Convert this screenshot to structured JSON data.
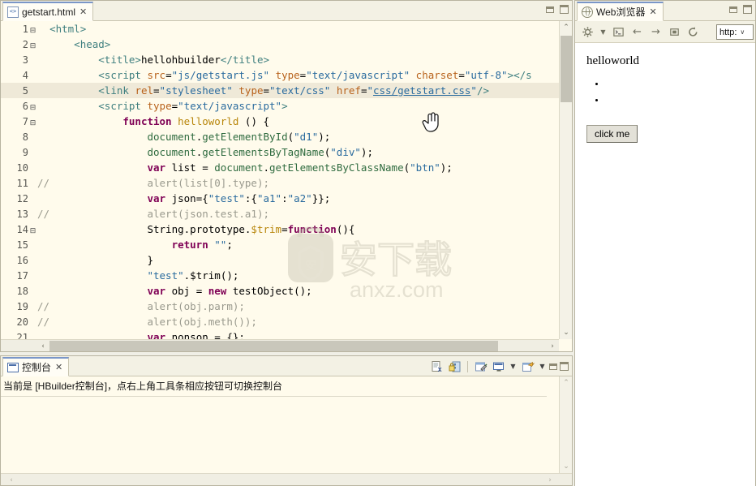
{
  "editor": {
    "tab": {
      "label": "getstart.html",
      "close": "✕",
      "icon": "html-file-icon"
    },
    "window_buttons": {
      "minimize": "minimize",
      "maximize": "maximize"
    },
    "lines": [
      {
        "num": "1",
        "fold": "⊟",
        "hl": false,
        "tokens": [
          {
            "t": "<",
            "c": "tag"
          },
          {
            "t": "html",
            "c": "tag"
          },
          {
            "t": ">",
            "c": "tag"
          }
        ]
      },
      {
        "num": "2",
        "fold": "⊟",
        "hl": false,
        "tokens": [
          {
            "t": "    ",
            "c": "plain"
          },
          {
            "t": "<head>",
            "c": "tag"
          }
        ]
      },
      {
        "num": "3",
        "fold": "",
        "hl": false,
        "tokens": [
          {
            "t": "        ",
            "c": "plain"
          },
          {
            "t": "<title>",
            "c": "tag"
          },
          {
            "t": "hellohbuilder",
            "c": "plain"
          },
          {
            "t": "</title>",
            "c": "tag"
          }
        ]
      },
      {
        "num": "4",
        "fold": "",
        "hl": false,
        "tokens": [
          {
            "t": "        ",
            "c": "plain"
          },
          {
            "t": "<script ",
            "c": "tag"
          },
          {
            "t": "src",
            "c": "attr2"
          },
          {
            "t": "=",
            "c": "plain"
          },
          {
            "t": "\"js/getstart.js\"",
            "c": "str"
          },
          {
            "t": " ",
            "c": "plain"
          },
          {
            "t": "type",
            "c": "attr2"
          },
          {
            "t": "=",
            "c": "plain"
          },
          {
            "t": "\"text/javascript\"",
            "c": "str"
          },
          {
            "t": " ",
            "c": "plain"
          },
          {
            "t": "charset",
            "c": "attr2"
          },
          {
            "t": "=",
            "c": "plain"
          },
          {
            "t": "\"utf-8\"",
            "c": "str"
          },
          {
            "t": "></s",
            "c": "tag"
          }
        ]
      },
      {
        "num": "5",
        "fold": "",
        "hl": true,
        "tokens": [
          {
            "t": "        ",
            "c": "plain"
          },
          {
            "t": "<link ",
            "c": "tag"
          },
          {
            "t": "rel",
            "c": "attr2"
          },
          {
            "t": "=",
            "c": "plain"
          },
          {
            "t": "\"stylesheet\"",
            "c": "str"
          },
          {
            "t": " ",
            "c": "plain"
          },
          {
            "t": "type",
            "c": "attr2"
          },
          {
            "t": "=",
            "c": "plain"
          },
          {
            "t": "\"text/css\"",
            "c": "str"
          },
          {
            "t": " ",
            "c": "plain"
          },
          {
            "t": "href",
            "c": "attr2"
          },
          {
            "t": "=",
            "c": "plain"
          },
          {
            "t": "\"",
            "c": "str"
          },
          {
            "t": "css/getstart.css",
            "c": "lnk"
          },
          {
            "t": "\"",
            "c": "str"
          },
          {
            "t": "/>",
            "c": "tag"
          }
        ]
      },
      {
        "num": "6",
        "fold": "⊟",
        "hl": false,
        "tokens": [
          {
            "t": "        ",
            "c": "plain"
          },
          {
            "t": "<script ",
            "c": "tag"
          },
          {
            "t": "type",
            "c": "attr2"
          },
          {
            "t": "=",
            "c": "plain"
          },
          {
            "t": "\"text/javascript\"",
            "c": "str"
          },
          {
            "t": ">",
            "c": "tag"
          }
        ]
      },
      {
        "num": "7",
        "fold": "⊟",
        "hl": false,
        "tokens": [
          {
            "t": "            ",
            "c": "plain"
          },
          {
            "t": "function",
            "c": "kw"
          },
          {
            "t": " ",
            "c": "plain"
          },
          {
            "t": "helloworld",
            "c": "fn"
          },
          {
            "t": " () {",
            "c": "plain"
          }
        ]
      },
      {
        "num": "8",
        "fold": "",
        "hl": false,
        "tokens": [
          {
            "t": "                ",
            "c": "plain"
          },
          {
            "t": "document",
            "c": "meth"
          },
          {
            "t": ".",
            "c": "plain"
          },
          {
            "t": "getElementById",
            "c": "meth"
          },
          {
            "t": "(",
            "c": "plain"
          },
          {
            "t": "\"d1\"",
            "c": "str"
          },
          {
            "t": ");",
            "c": "plain"
          }
        ]
      },
      {
        "num": "9",
        "fold": "",
        "hl": false,
        "tokens": [
          {
            "t": "                ",
            "c": "plain"
          },
          {
            "t": "document",
            "c": "meth"
          },
          {
            "t": ".",
            "c": "plain"
          },
          {
            "t": "getElementsByTagName",
            "c": "meth"
          },
          {
            "t": "(",
            "c": "plain"
          },
          {
            "t": "\"div\"",
            "c": "str"
          },
          {
            "t": ");",
            "c": "plain"
          }
        ]
      },
      {
        "num": "10",
        "fold": "",
        "hl": false,
        "tokens": [
          {
            "t": "                ",
            "c": "plain"
          },
          {
            "t": "var",
            "c": "kw"
          },
          {
            "t": " list = ",
            "c": "plain"
          },
          {
            "t": "document",
            "c": "meth"
          },
          {
            "t": ".",
            "c": "plain"
          },
          {
            "t": "getElementsByClassName",
            "c": "meth"
          },
          {
            "t": "(",
            "c": "plain"
          },
          {
            "t": "\"btn\"",
            "c": "str"
          },
          {
            "t": ");",
            "c": "plain"
          }
        ]
      },
      {
        "num": "11",
        "fold": "",
        "hl": false,
        "comment": "//",
        "tokens": [
          {
            "t": "                ",
            "c": "plain"
          },
          {
            "t": "alert(list[0].type);",
            "c": "cmt"
          }
        ]
      },
      {
        "num": "12",
        "fold": "",
        "hl": false,
        "tokens": [
          {
            "t": "                ",
            "c": "plain"
          },
          {
            "t": "var",
            "c": "kw"
          },
          {
            "t": " json={",
            "c": "plain"
          },
          {
            "t": "\"test\"",
            "c": "str"
          },
          {
            "t": ":{",
            "c": "plain"
          },
          {
            "t": "\"a1\"",
            "c": "str"
          },
          {
            "t": ":",
            "c": "plain"
          },
          {
            "t": "\"a2\"",
            "c": "str"
          },
          {
            "t": "}};",
            "c": "plain"
          }
        ]
      },
      {
        "num": "13",
        "fold": "",
        "hl": false,
        "comment": "//",
        "tokens": [
          {
            "t": "                ",
            "c": "plain"
          },
          {
            "t": "alert(json.test.a1);",
            "c": "cmt"
          }
        ]
      },
      {
        "num": "14",
        "fold": "⊟",
        "hl": false,
        "tokens": [
          {
            "t": "                ",
            "c": "plain"
          },
          {
            "t": "String.prototype.",
            "c": "plain"
          },
          {
            "t": "$trim",
            "c": "fn"
          },
          {
            "t": "=",
            "c": "plain"
          },
          {
            "t": "function",
            "c": "kw"
          },
          {
            "t": "(){",
            "c": "plain"
          }
        ]
      },
      {
        "num": "15",
        "fold": "",
        "hl": false,
        "tokens": [
          {
            "t": "                    ",
            "c": "plain"
          },
          {
            "t": "return",
            "c": "kw"
          },
          {
            "t": " ",
            "c": "plain"
          },
          {
            "t": "\"\"",
            "c": "str"
          },
          {
            "t": ";",
            "c": "plain"
          }
        ]
      },
      {
        "num": "16",
        "fold": "",
        "hl": false,
        "tokens": [
          {
            "t": "                ",
            "c": "plain"
          },
          {
            "t": "}",
            "c": "plain"
          }
        ]
      },
      {
        "num": "17",
        "fold": "",
        "hl": false,
        "tokens": [
          {
            "t": "                ",
            "c": "plain"
          },
          {
            "t": "\"test\"",
            "c": "str"
          },
          {
            "t": ".",
            "c": "plain"
          },
          {
            "t": "$trim",
            "c": "plain"
          },
          {
            "t": "();",
            "c": "plain"
          }
        ]
      },
      {
        "num": "18",
        "fold": "",
        "hl": false,
        "tokens": [
          {
            "t": "                ",
            "c": "plain"
          },
          {
            "t": "var",
            "c": "kw"
          },
          {
            "t": " obj = ",
            "c": "plain"
          },
          {
            "t": "new",
            "c": "kw"
          },
          {
            "t": " testObject();",
            "c": "plain"
          }
        ]
      },
      {
        "num": "19",
        "fold": "",
        "hl": false,
        "comment": "//",
        "tokens": [
          {
            "t": "                ",
            "c": "plain"
          },
          {
            "t": "alert(obj.parm);",
            "c": "cmt"
          }
        ]
      },
      {
        "num": "20",
        "fold": "",
        "hl": false,
        "comment": "//",
        "tokens": [
          {
            "t": "                ",
            "c": "plain"
          },
          {
            "t": "alert(obj.meth());",
            "c": "cmt"
          }
        ]
      },
      {
        "num": "21",
        "fold": "",
        "hl": false,
        "tokens": [
          {
            "t": "                ",
            "c": "plain"
          },
          {
            "t": "var",
            "c": "kw"
          },
          {
            "t": " nonson = {};",
            "c": "plain"
          }
        ]
      }
    ],
    "scroll": {
      "up_arrow": "⌃",
      "down_arrow": "⌄",
      "left_arrow": "‹",
      "right_arrow": "›"
    }
  },
  "browser": {
    "tab": {
      "label": "Web浏览器",
      "close": "✕",
      "icon": "globe-icon"
    },
    "window_buttons": {
      "minimize": "minimize",
      "maximize": "maximize"
    },
    "toolbar": {
      "settings_icon": "⚙",
      "settings_caret": "▼",
      "terminal_icon": "▸_",
      "back_icon": "←",
      "forward_icon": "→",
      "stop_icon": "▣",
      "refresh_icon": "⟳",
      "url_value": "http:",
      "url_caret": "∨"
    },
    "page": {
      "heading": "helloworld",
      "bullets": [
        "",
        ""
      ],
      "button_label": "click me"
    }
  },
  "console": {
    "tab": {
      "label": "控制台",
      "close": "✕",
      "icon": "console-icon"
    },
    "toolbar": {
      "clear_console": "clear-console-icon",
      "scroll_lock": "scroll-lock-icon",
      "pin_console": "pin-console-icon",
      "display_console": "display-selected-console-icon",
      "display_caret": "▼",
      "open_console": "open-console-icon",
      "open_caret": "▼"
    },
    "window_buttons": {
      "minimize": "minimize",
      "maximize": "maximize"
    },
    "message": "当前是 [HBuilder控制台]，点右上角工具条相应按钮可切换控制台",
    "scroll": {
      "up_arrow": "⌃",
      "down_arrow": "⌄",
      "right_arrow": "›"
    }
  },
  "watermark": {
    "text": "anxz.com",
    "logo_text": "安",
    "big_text": "安下载"
  },
  "colors": {
    "editor_bg": "#fffbec",
    "highlight_line": "#efe9d8",
    "chrome": "#f3f1e4",
    "border": "#b8b4a0",
    "link": "#2a6b9e"
  }
}
